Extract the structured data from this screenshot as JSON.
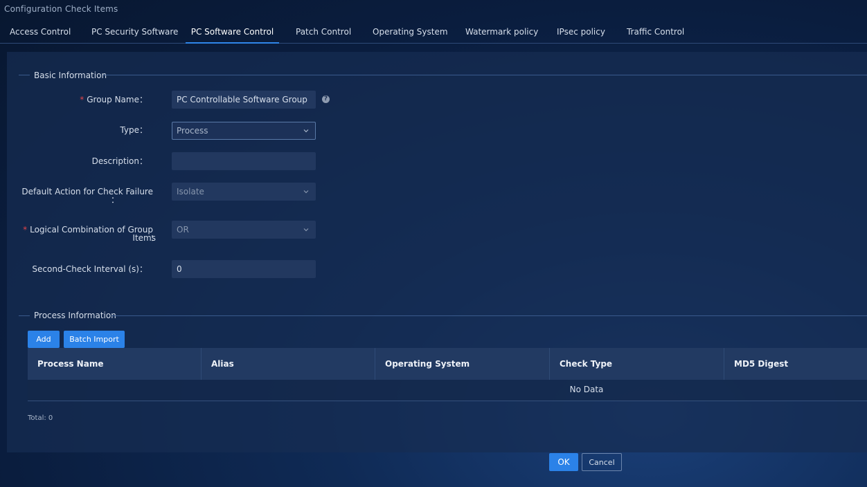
{
  "window": {
    "title": "Configuration Check Items"
  },
  "tabs": [
    {
      "label": "Access Control"
    },
    {
      "label": "PC Security Software"
    },
    {
      "label": "PC Software Control"
    },
    {
      "label": "Patch Control"
    },
    {
      "label": "Operating System"
    },
    {
      "label": "Watermark policy"
    },
    {
      "label": "IPsec policy"
    },
    {
      "label": "Traffic Control"
    }
  ],
  "active_tab": "PC Software Control",
  "basic_info": {
    "title": "Basic Information",
    "group_name": {
      "label": "Group Name",
      "colon": "：",
      "value": "PC Controllable Software Group",
      "required": "*"
    },
    "help_icon": "?",
    "type": {
      "label": "Type",
      "colon": "：",
      "value": "Process"
    },
    "description": {
      "label": "Description",
      "colon": "：",
      "value": ""
    },
    "default_action": {
      "label": "Default Action for Check Failure",
      "colon": "：",
      "value": "Isolate"
    },
    "logical_combination": {
      "label_line1": "Logical Combination of Group",
      "label_line2": "Items",
      "colon": "：",
      "value": "OR",
      "required": "*"
    },
    "second_check": {
      "label": "Second-Check Interval (s)",
      "colon": "：",
      "value": "0"
    }
  },
  "process_info": {
    "title": "Process Information",
    "add_label": "Add",
    "batch_import_label": "Batch Import",
    "columns": [
      "Process Name",
      "Alias",
      "Operating System",
      "Check Type",
      "MD5 Digest"
    ],
    "empty_text": "No Data",
    "total_label": "Total: 0"
  },
  "footer": {
    "ok_label": "OK",
    "cancel_label": "Cancel"
  },
  "colors": {
    "accent": "#2b82e8",
    "required": "#e2454a"
  }
}
